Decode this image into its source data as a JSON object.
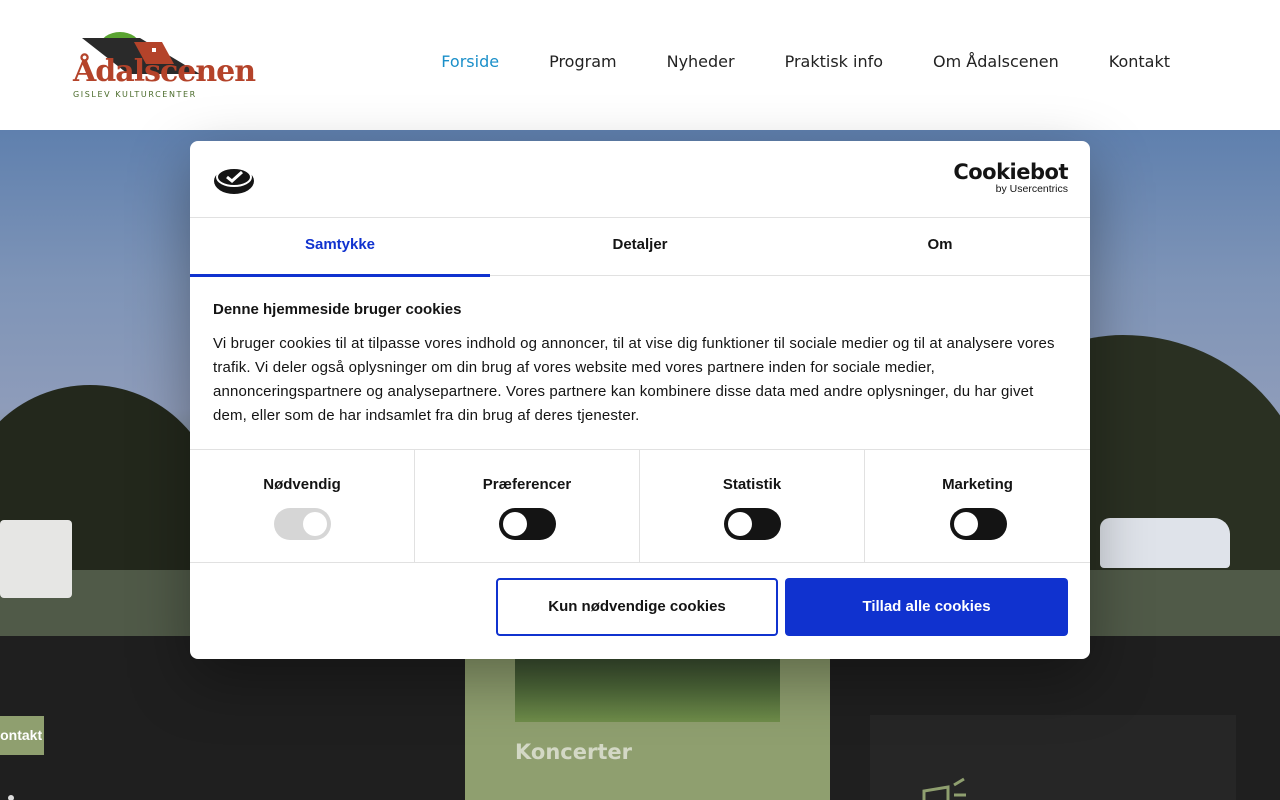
{
  "header": {
    "logo_text": "Ådalscenen",
    "logo_sub": "GISLEV  KULTURCENTER",
    "nav": [
      {
        "label": "Forside"
      },
      {
        "label": "Program"
      },
      {
        "label": "Nyheder"
      },
      {
        "label": "Praktisk info"
      },
      {
        "label": "Om Ådalscenen"
      },
      {
        "label": "Kontakt"
      }
    ],
    "active_color": "#1a8fc9"
  },
  "page": {
    "contact_button": "Kontakt os",
    "card_title": "Koncerter"
  },
  "cookie_dialog": {
    "brand_main": "Cookiebot",
    "brand_sub": "by Usercentrics",
    "tabs": [
      {
        "label": "Samtykke"
      },
      {
        "label": "Detaljer"
      },
      {
        "label": "Om"
      }
    ],
    "title": "Denne hjemmeside bruger cookies",
    "text": "Vi bruger cookies til at tilpasse vores indhold og annoncer, til at vise dig funktioner til sociale medier og til at analysere vores trafik. Vi deler også oplysninger om din brug af vores website med vores partnere inden for sociale medier, annonceringspartnere og analysepartnere. Vores partnere kan kombinere disse data med andre oplysninger, du har givet dem, eller som de har indsamlet fra din brug af deres tjenester.",
    "categories": [
      {
        "label": "Nødvendig",
        "state": "on-disabled"
      },
      {
        "label": "Præferencer",
        "state": "off"
      },
      {
        "label": "Statistik",
        "state": "off"
      },
      {
        "label": "Marketing",
        "state": "off"
      }
    ],
    "btn_necessary": "Kun nødvendige cookies",
    "btn_allow_all": "Tillad alle cookies",
    "accent_color": "#1032cf"
  }
}
